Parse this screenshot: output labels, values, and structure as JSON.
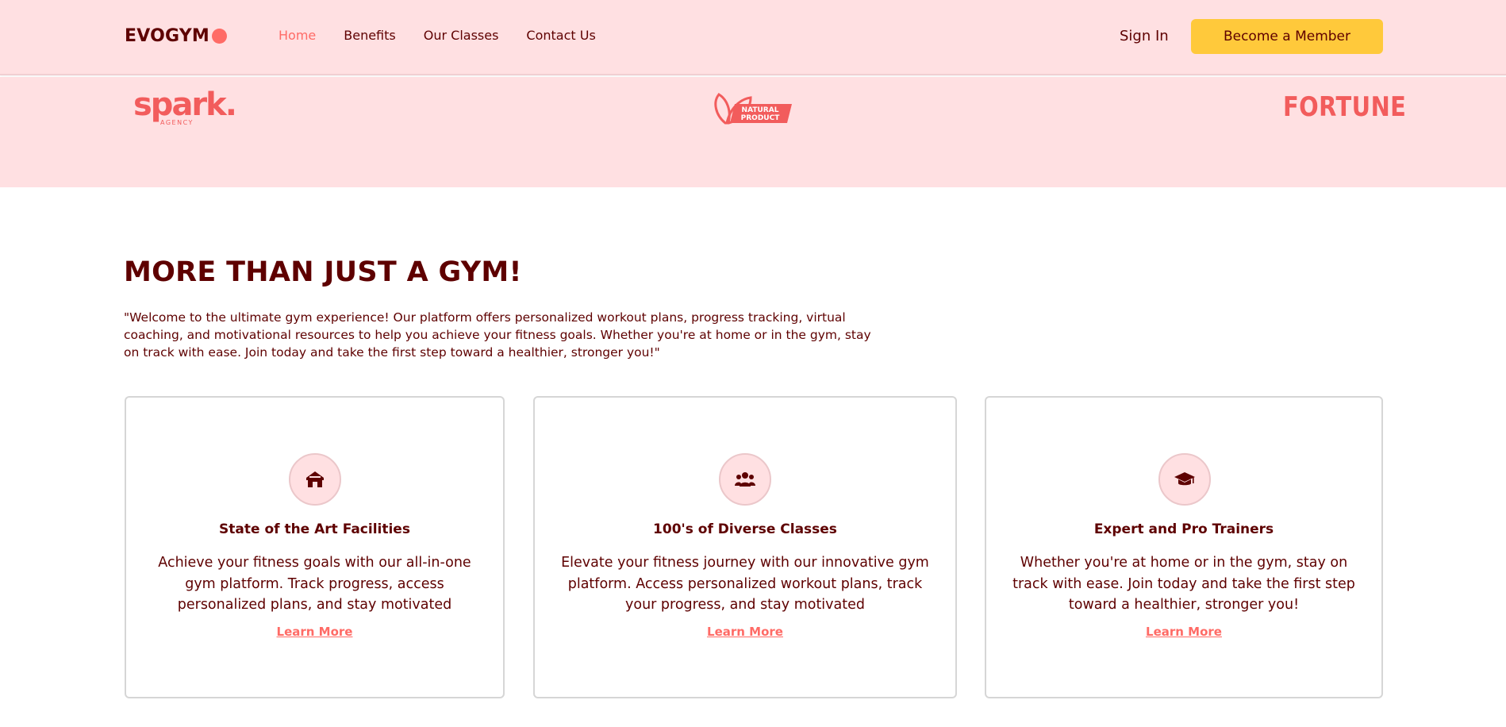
{
  "brand": {
    "name": "EVOGYM",
    "accent": "#ff6b66",
    "dark": "#5e0000",
    "pink": "#ffe0e2",
    "yellow": "#ffc93b"
  },
  "nav": {
    "links": [
      {
        "label": "Home",
        "active": true
      },
      {
        "label": "Benefits",
        "active": false
      },
      {
        "label": "Our Classes",
        "active": false
      },
      {
        "label": "Contact Us",
        "active": false
      }
    ],
    "sign_in": "Sign In",
    "cta": "Become a Member"
  },
  "sponsors": {
    "spark": {
      "name": "spark.",
      "sub": "AGENCY"
    },
    "natural": {
      "line1": "NATURAL",
      "line2": "PRODUCT"
    },
    "fortune": {
      "name": "FORTUNE"
    }
  },
  "benefits": {
    "heading": "MORE THAN JUST A GYM!",
    "intro": "\"Welcome to the ultimate gym experience! Our platform offers personalized workout plans, progress tracking, virtual coaching, and motivational resources to help you achieve your fitness goals. Whether you're at home or in the gym, stay on track with ease. Join today and take the first step toward a healthier, stronger you!\"",
    "cards": [
      {
        "icon": "home-icon",
        "title": "State of the Art Facilities",
        "text": "Achieve your fitness goals with our all-in-one gym platform. Track progress, access personalized plans, and stay motivated",
        "link": "Learn More"
      },
      {
        "icon": "users-icon",
        "title": "100's of Diverse Classes",
        "text": "Elevate your fitness journey with our innovative gym platform. Access personalized workout plans, track your progress, and stay motivated",
        "link": "Learn More"
      },
      {
        "icon": "graduation-cap-icon",
        "title": "Expert and Pro Trainers",
        "text": "Whether you're at home or in the gym, stay on track with ease. Join today and take the first step toward a healthier, stronger you!",
        "link": "Learn More"
      }
    ]
  }
}
